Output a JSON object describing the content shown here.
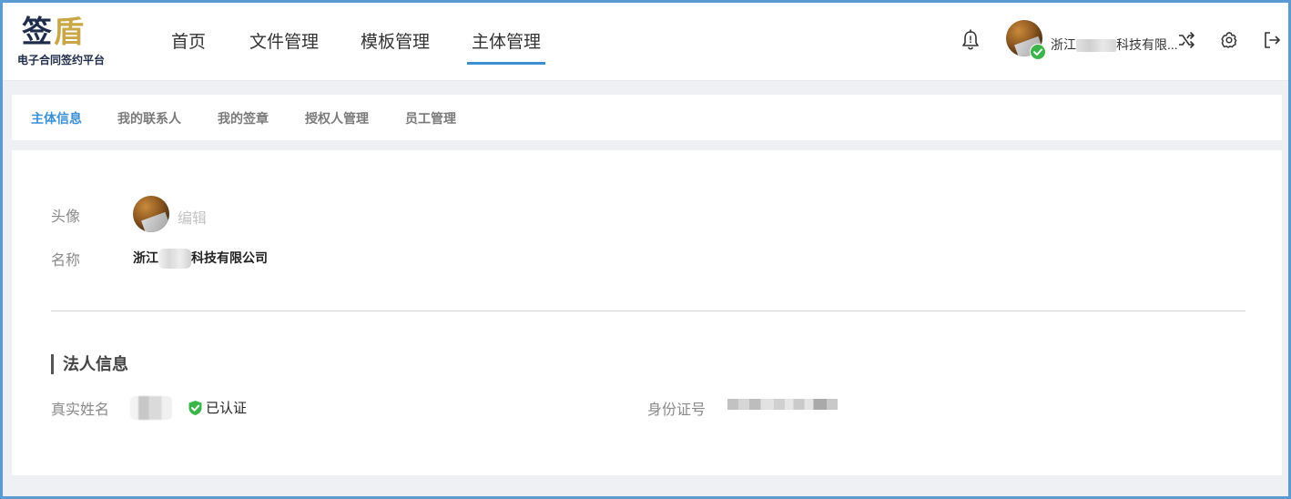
{
  "header": {
    "logo_main_a": "签",
    "logo_main_b": "盾",
    "logo_sub": "电子合同签约平台",
    "nav": [
      {
        "label": "首页"
      },
      {
        "label": "文件管理"
      },
      {
        "label": "模板管理"
      },
      {
        "label": "主体管理"
      }
    ],
    "active_nav": "主体管理",
    "company_prefix": "浙江",
    "company_suffix": "科技有限..."
  },
  "tabs": [
    {
      "label": "主体信息"
    },
    {
      "label": "我的联系人"
    },
    {
      "label": "我的签章"
    },
    {
      "label": "授权人管理"
    },
    {
      "label": "员工管理"
    }
  ],
  "active_tab": "主体信息",
  "profile": {
    "avatar_label": "头像",
    "edit_label": "编辑",
    "name_label": "名称",
    "name_prefix": "浙江",
    "name_suffix": "科技有限公司"
  },
  "legal_person": {
    "section_title": "法人信息",
    "real_name_label": "真实姓名",
    "verified_label": "已认证",
    "id_label": "身份证号"
  },
  "colors": {
    "accent": "#3b8fd3",
    "verified_green": "#3bb54a",
    "frame_border": "#5b9bd5"
  },
  "icons": {
    "notification": "bell-icon",
    "switch": "switch-account-icon",
    "settings": "gear-icon",
    "logout": "logout-icon",
    "verified": "shield-check-icon"
  }
}
